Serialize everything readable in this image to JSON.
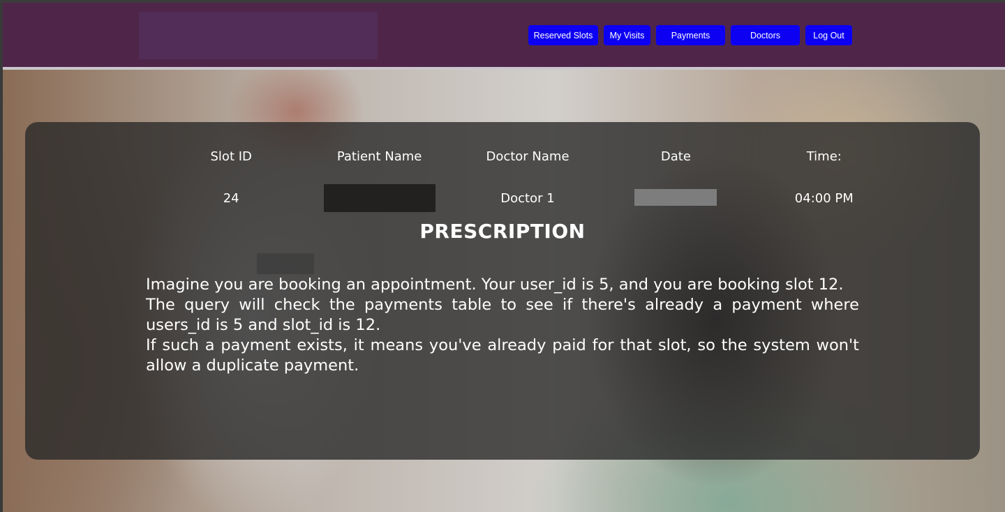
{
  "navbar": {
    "buttons": [
      {
        "label": "Reserved Slots"
      },
      {
        "label": "My Visits"
      },
      {
        "label": "Payments"
      },
      {
        "label": "Doctors"
      },
      {
        "label": "Log Out"
      }
    ]
  },
  "table": {
    "headers": [
      "Slot ID",
      "Patient Name",
      "Doctor Name",
      "Date",
      "Time:"
    ],
    "row": {
      "slot_id": "24",
      "patient_name": "",
      "doctor_name": "Doctor 1",
      "date": "",
      "time": "04:00 PM"
    }
  },
  "prescription": {
    "title": "PRESCRIPTION",
    "lines": [
      "Imagine you are booking an appointment. Your user_id is 5, and you are booking slot 12.",
      "The query will check the payments table to see if there's already a payment where users_id is 5 and slot_id is 12.",
      "If such a payment exists, it means you've already paid for that slot, so the system won't allow a duplicate payment."
    ]
  },
  "colors": {
    "navbar_bg": "#4f2649",
    "button_bg": "#0d00f2",
    "card_bg": "rgba(40,40,40,0.78)"
  }
}
